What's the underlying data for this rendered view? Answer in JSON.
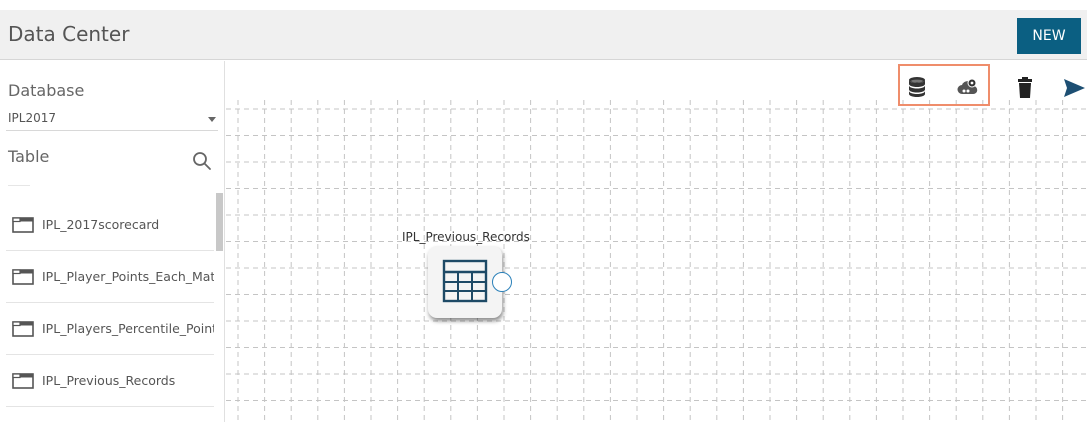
{
  "app": {
    "title": "Data Center",
    "new_label": "NEW"
  },
  "sidebar": {
    "database_label": "Database",
    "database_value": "IPL2017",
    "table_label": "Table",
    "tables": [
      "IPL_2017scorecard",
      "IPL_Player_Points_Each_Matc...",
      "IPL_Players_Percentile_Points",
      "IPL_Previous_Records"
    ]
  },
  "toolbar": {
    "icons": [
      "database-stack-icon",
      "cloud-settings-icon",
      "trash-icon",
      "send-icon"
    ],
    "highlight_color": "#ef8d6b"
  },
  "canvas": {
    "node_label": "IPL_Previous_Records",
    "node_icon": "table-grid-icon",
    "port_color": "#2a80b9"
  },
  "colors": {
    "accent": "#0b5f82",
    "icon": "#333333"
  }
}
